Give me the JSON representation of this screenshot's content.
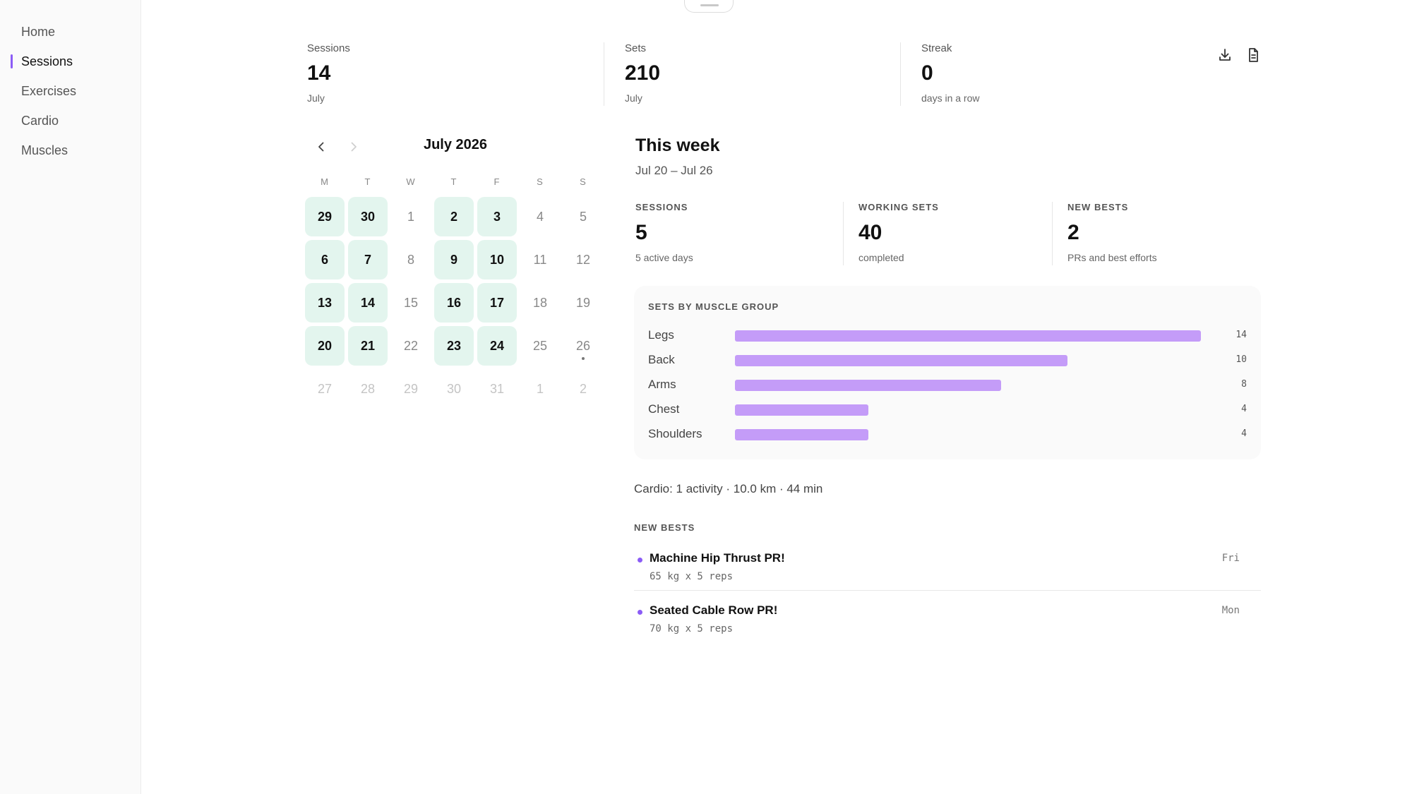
{
  "sidebar": {
    "items": [
      {
        "label": "Home"
      },
      {
        "label": "Sessions"
      },
      {
        "label": "Exercises"
      },
      {
        "label": "Cardio"
      },
      {
        "label": "Muscles"
      }
    ],
    "active": "Sessions",
    "accent_color": "#8b5cf6"
  },
  "stats": {
    "sessions": {
      "label": "Sessions",
      "value": "14",
      "sub": "July"
    },
    "sets": {
      "label": "Sets",
      "value": "210",
      "sub": "July"
    },
    "streak": {
      "label": "Streak",
      "value": "0",
      "sub": "days in a row"
    }
  },
  "toolbar": {
    "download_icon": "download-icon",
    "document_icon": "document-icon"
  },
  "calendar": {
    "title": "July 2026",
    "weekdays": [
      "M",
      "T",
      "W",
      "T",
      "F",
      "S",
      "S"
    ],
    "weeks": [
      [
        {
          "d": "29",
          "s": "active"
        },
        {
          "d": "30",
          "s": "active"
        },
        {
          "d": "1",
          "s": "plain"
        },
        {
          "d": "2",
          "s": "active"
        },
        {
          "d": "3",
          "s": "active"
        },
        {
          "d": "4",
          "s": "plain"
        },
        {
          "d": "5",
          "s": "plain"
        }
      ],
      [
        {
          "d": "6",
          "s": "active"
        },
        {
          "d": "7",
          "s": "active"
        },
        {
          "d": "8",
          "s": "plain"
        },
        {
          "d": "9",
          "s": "active"
        },
        {
          "d": "10",
          "s": "active"
        },
        {
          "d": "11",
          "s": "plain"
        },
        {
          "d": "12",
          "s": "plain"
        }
      ],
      [
        {
          "d": "13",
          "s": "active"
        },
        {
          "d": "14",
          "s": "active"
        },
        {
          "d": "15",
          "s": "plain"
        },
        {
          "d": "16",
          "s": "active"
        },
        {
          "d": "17",
          "s": "active"
        },
        {
          "d": "18",
          "s": "plain"
        },
        {
          "d": "19",
          "s": "plain"
        }
      ],
      [
        {
          "d": "20",
          "s": "active"
        },
        {
          "d": "21",
          "s": "active"
        },
        {
          "d": "22",
          "s": "plain"
        },
        {
          "d": "23",
          "s": "active"
        },
        {
          "d": "24",
          "s": "active"
        },
        {
          "d": "25",
          "s": "plain"
        },
        {
          "d": "26",
          "s": "plain"
        }
      ],
      [
        {
          "d": "27",
          "s": "faded"
        },
        {
          "d": "28",
          "s": "faded"
        },
        {
          "d": "29",
          "s": "faded"
        },
        {
          "d": "30",
          "s": "faded"
        },
        {
          "d": "31",
          "s": "faded"
        },
        {
          "d": "1",
          "s": "faded"
        },
        {
          "d": "2",
          "s": "faded"
        }
      ]
    ],
    "active_color": "#e3f5ee"
  },
  "week": {
    "title": "This week",
    "range": "Jul 20 – Jul 26",
    "stats": [
      {
        "label": "SESSIONS",
        "value": "5",
        "sub": "5 active days"
      },
      {
        "label": "WORKING SETS",
        "value": "40",
        "sub": "completed"
      },
      {
        "label": "NEW BESTS",
        "value": "2",
        "sub": "PRs and best efforts"
      }
    ]
  },
  "muscle_groups": {
    "title": "SETS BY MUSCLE GROUP",
    "bar_color": "#c49cf8",
    "max": 14,
    "rows": [
      {
        "name": "Legs",
        "value": 14
      },
      {
        "name": "Back",
        "value": 10
      },
      {
        "name": "Arms",
        "value": 8
      },
      {
        "name": "Chest",
        "value": 4
      },
      {
        "name": "Shoulders",
        "value": 4
      }
    ]
  },
  "cardio": {
    "summary": "Cardio: 1 activity · 10.0 km · 44 min"
  },
  "bests": {
    "title": "NEW BESTS",
    "items": [
      {
        "name": "Machine Hip Thrust PR!",
        "detail": "65 kg x 5 reps",
        "day": "Fri"
      },
      {
        "name": "Seated Cable Row PR!",
        "detail": "70 kg x 5 reps",
        "day": "Mon"
      }
    ]
  }
}
